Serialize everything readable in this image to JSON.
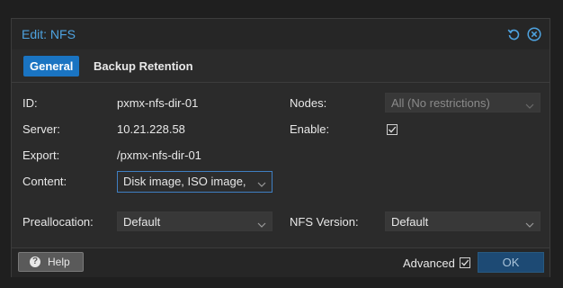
{
  "dialog": {
    "title": "Edit: NFS",
    "reset_icon": "reset-icon",
    "close_icon": "close-icon"
  },
  "tabs": [
    {
      "label": "General",
      "active": true
    },
    {
      "label": "Backup Retention",
      "active": false
    }
  ],
  "form": {
    "id_label": "ID:",
    "id_value": "pxmx-nfs-dir-01",
    "server_label": "Server:",
    "server_value": "10.21.228.58",
    "export_label": "Export:",
    "export_value": "/pxmx-nfs-dir-01",
    "content_label": "Content:",
    "content_value": "Disk image, ISO image,",
    "nodes_label": "Nodes:",
    "nodes_value": "All (No restrictions)",
    "enable_label": "Enable:",
    "enable_checked": true,
    "preallocation_label": "Preallocation:",
    "preallocation_value": "Default",
    "nfs_version_label": "NFS Version:",
    "nfs_version_value": "Default"
  },
  "footer": {
    "help_label": "Help",
    "advanced_label": "Advanced",
    "advanced_checked": true,
    "ok_label": "OK"
  },
  "colors": {
    "accent": "#1a74c2",
    "title": "#4ea3e0",
    "background": "#2b2b2b"
  }
}
